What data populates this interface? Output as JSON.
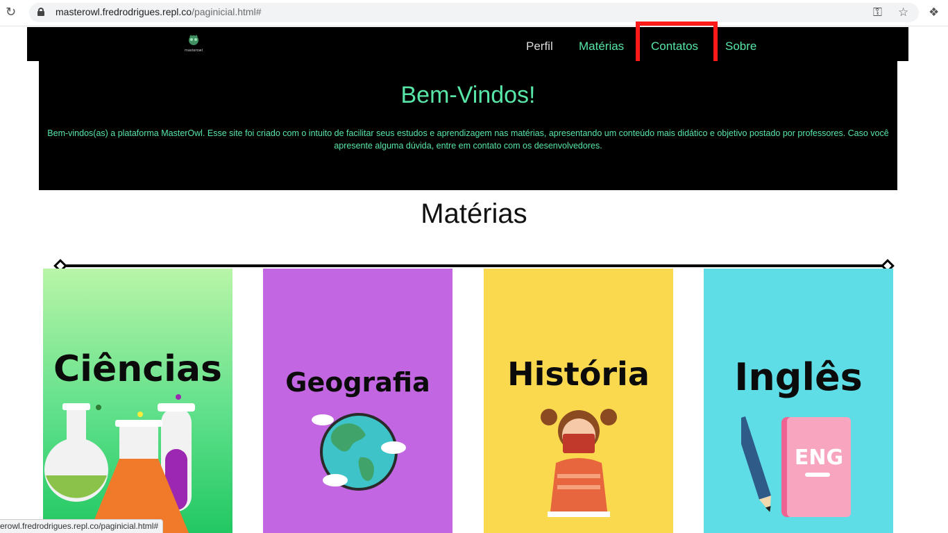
{
  "browser": {
    "url_host": "masterowl.fredrodrigues.repl.co",
    "url_path": "/paginicial.html#",
    "status_text": "erowl.fredrodrigues.repl.co/paginicial.html#"
  },
  "nav": {
    "logo_text": "masterowl",
    "items": [
      {
        "label": "Perfil"
      },
      {
        "label": "Matérias"
      },
      {
        "label": "Contatos"
      },
      {
        "label": "Sobre"
      }
    ]
  },
  "hero": {
    "title": "Bem-Vindos!",
    "text": "Bem-vindos(as) a plataforma MasterOwl. Esse site foi criado com o intuito de facilitar seus estudos e aprendizagem nas matérias, apresentando um conteúdo mais didático e objetivo postado por professores. Caso você apresente alguma dúvida, entre em contato com os desenvolvedores."
  },
  "subjects": {
    "title": "Matérias",
    "cards": [
      {
        "label": "Ciências",
        "color": "#5fe08a"
      },
      {
        "label": "Geografia",
        "color": "#c266e2"
      },
      {
        "label": "História",
        "color": "#fbd94f"
      },
      {
        "label": "Inglês",
        "color": "#5fdde6",
        "book_text": "ENG"
      }
    ]
  },
  "colors": {
    "accent": "#58e6a8",
    "highlight": "#ff1a1a",
    "header_bg": "#000000"
  }
}
